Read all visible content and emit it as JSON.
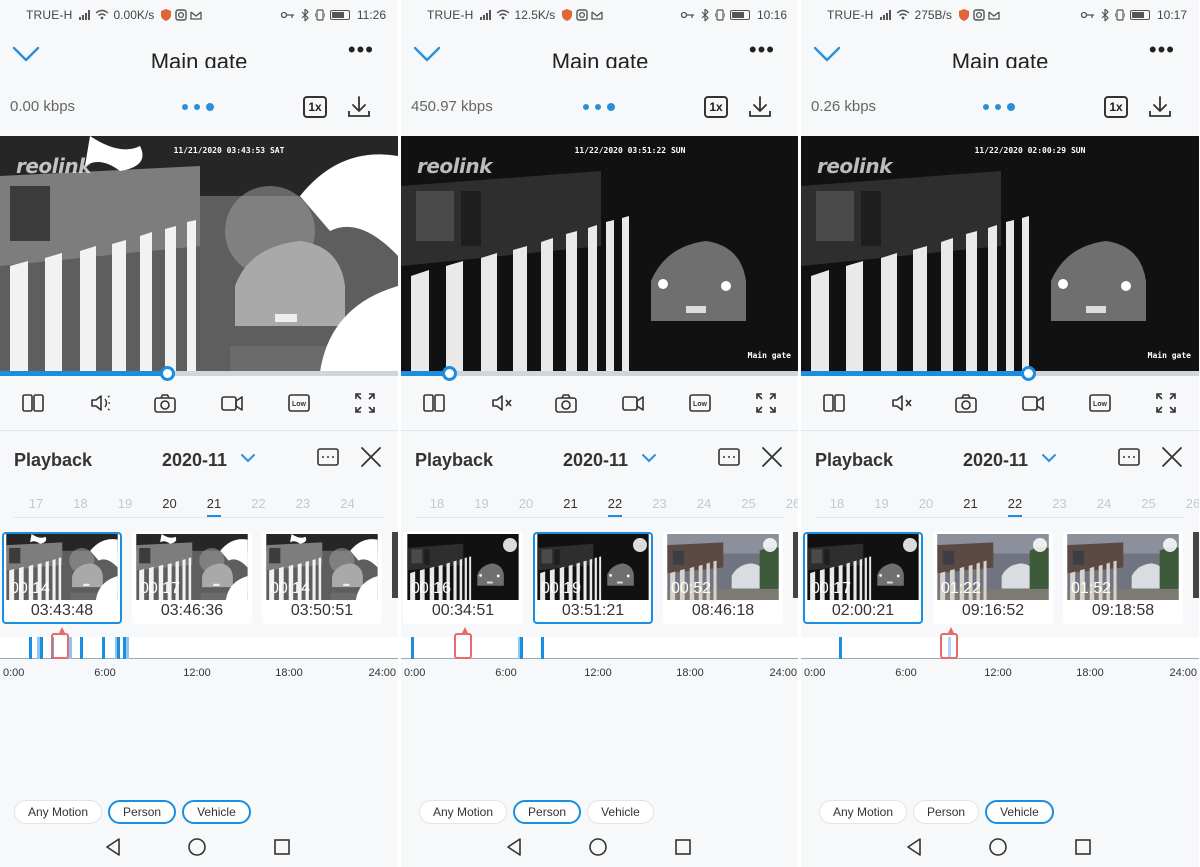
{
  "panels": [
    {
      "status": {
        "carrier": "TRUE-H",
        "speed": "0.00K/s",
        "time": "11:26"
      },
      "header": {
        "title": "Main gate"
      },
      "stream": {
        "bitrate": "0.00 kbps",
        "speed_label": "1x"
      },
      "video": {
        "watermark": "reolink",
        "timestamp": "11/21/2020 03:43:53 SAT",
        "camera_label": "Main gate",
        "progress": 0.42
      },
      "playback": {
        "title": "Playback",
        "month": "2020-11",
        "days": [
          "17",
          "18",
          "19",
          "20",
          "21",
          "22",
          "23",
          "24"
        ],
        "selected_day": "21",
        "available_days": [
          "20",
          "21"
        ],
        "clips": [
          {
            "duration": "00:14",
            "time": "03:43:48",
            "selected": true,
            "style": "night-bright"
          },
          {
            "duration": "00:17",
            "time": "03:46:36",
            "selected": false,
            "style": "night-bright"
          },
          {
            "duration": "00:14",
            "time": "03:50:51",
            "selected": false,
            "style": "night-bright"
          }
        ],
        "timeline": {
          "events_hours": [
            1.8,
            2.3,
            2.5,
            3.2,
            4.3,
            5.0,
            6.4,
            7.2,
            7.3,
            7.7,
            7.9
          ],
          "cursor_hour": 3.72,
          "labels": [
            "0:00",
            "6:00",
            "12:00",
            "18:00",
            "24:00"
          ]
        },
        "filters": [
          {
            "label": "Any Motion",
            "active": false
          },
          {
            "label": "Person",
            "active": true
          },
          {
            "label": "Vehicle",
            "active": true
          }
        ]
      }
    },
    {
      "status": {
        "carrier": "TRUE-H",
        "speed": "12.5K/s",
        "time": "10:16"
      },
      "header": {
        "title": "Main gate"
      },
      "stream": {
        "bitrate": "450.97 kbps",
        "speed_label": "1x"
      },
      "video": {
        "watermark": "reolink",
        "timestamp": "11/22/2020 03:51:22 SUN",
        "camera_label": "Main gate",
        "progress": 0.12
      },
      "playback": {
        "title": "Playback",
        "month": "2020-11",
        "days": [
          "18",
          "19",
          "20",
          "21",
          "22",
          "23",
          "24",
          "25",
          "26"
        ],
        "selected_day": "22",
        "available_days": [
          "21",
          "22"
        ],
        "clips": [
          {
            "duration": "00:16",
            "time": "00:34:51",
            "selected": false,
            "style": "night-dark"
          },
          {
            "duration": "00:19",
            "time": "03:51:21",
            "selected": true,
            "style": "night-dark"
          },
          {
            "duration": "00:52",
            "time": "08:46:18",
            "selected": false,
            "style": "day"
          }
        ],
        "timeline": {
          "events_hours": [
            0.6,
            7.3,
            7.45,
            8.75
          ],
          "cursor_hour": 3.85,
          "labels": [
            "0:00",
            "6:00",
            "12:00",
            "18:00",
            "24:00"
          ]
        },
        "filters": [
          {
            "label": "Any Motion",
            "active": false
          },
          {
            "label": "Person",
            "active": true
          },
          {
            "label": "Vehicle",
            "active": false
          }
        ]
      }
    },
    {
      "status": {
        "carrier": "TRUE-H",
        "speed": "275B/s",
        "time": "10:17"
      },
      "header": {
        "title": "Main gate"
      },
      "stream": {
        "bitrate": "0.26 kbps",
        "speed_label": "1x"
      },
      "video": {
        "watermark": "reolink",
        "timestamp": "11/22/2020 02:00:29 SUN",
        "camera_label": "Main gate",
        "progress": 0.57
      },
      "playback": {
        "title": "Playback",
        "month": "2020-11",
        "days": [
          "18",
          "19",
          "20",
          "21",
          "22",
          "23",
          "24",
          "25",
          "26"
        ],
        "selected_day": "22",
        "available_days": [
          "21",
          "22"
        ],
        "clips": [
          {
            "duration": "00:17",
            "time": "02:00:21",
            "selected": true,
            "style": "night-dark"
          },
          {
            "duration": "01:22",
            "time": "09:16:52",
            "selected": false,
            "style": "day"
          },
          {
            "duration": "01:52",
            "time": "09:18:58",
            "selected": false,
            "style": "day"
          }
        ],
        "timeline": {
          "events_hours": [
            2.4,
            9.2
          ],
          "cursor_hour": 9.25,
          "labels": [
            "0:00",
            "6:00",
            "12:00",
            "18:00",
            "24:00"
          ]
        },
        "filters": [
          {
            "label": "Any Motion",
            "active": false
          },
          {
            "label": "Person",
            "active": false
          },
          {
            "label": "Vehicle",
            "active": true
          }
        ]
      }
    }
  ],
  "colors": {
    "accent": "#1a8ee0",
    "cursor": "#e86a6a",
    "background": "#f6f8fa"
  },
  "toolbar_icons": [
    "split-view-icon",
    "speaker-icon",
    "camera-snapshot-icon",
    "video-record-icon",
    "quality-low-icon",
    "fullscreen-icon"
  ],
  "toolbar_quality_label": "Low",
  "nav_icons": [
    "back-triangle-icon",
    "home-circle-icon",
    "recents-square-icon"
  ]
}
